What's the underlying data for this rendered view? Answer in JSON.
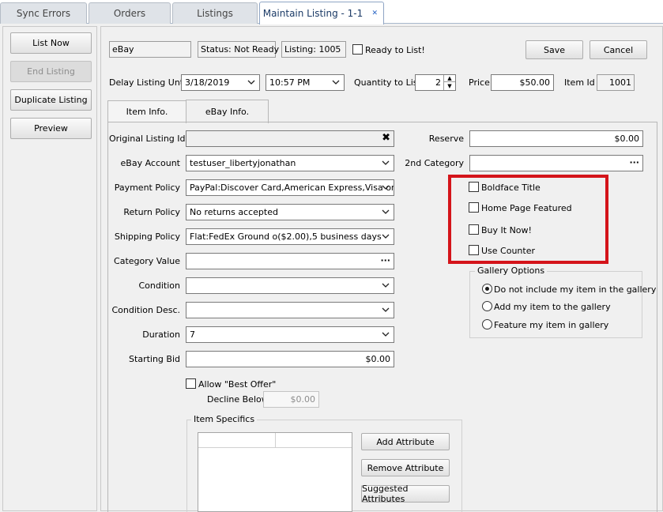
{
  "tabs": [
    {
      "label": "Sync Errors"
    },
    {
      "label": "Orders"
    },
    {
      "label": "Listings"
    },
    {
      "label": "Maintain Listing - 1-1",
      "active": true
    }
  ],
  "left_buttons": {
    "list_now": "List Now",
    "end_listing": "End Listing",
    "duplicate_listing": "Duplicate Listing",
    "preview": "Preview"
  },
  "header": {
    "marketplace": "eBay",
    "status": "Status: Not Ready",
    "listing": "Listing: 1005",
    "ready_label": "Ready to List!",
    "save": "Save",
    "cancel": "Cancel"
  },
  "row2": {
    "delay_label": "Delay Listing Until",
    "date": "3/18/2019",
    "time": "10:57 PM",
    "qty_label": "Quantity to List",
    "qty": "2",
    "price_label": "Price",
    "price": "$50.00",
    "itemid_label": "Item Id",
    "itemid": "1001"
  },
  "inner_tabs": [
    {
      "label": "Item Info."
    },
    {
      "label": "eBay Info.",
      "active": true
    }
  ],
  "form": {
    "original_listing_id_label": "Original Listing Id",
    "original_listing_id": "",
    "ebay_account_label": "eBay Account",
    "ebay_account": "testuser_libertyjonathan",
    "payment_policy_label": "Payment Policy",
    "payment_policy": "PayPal:Discover Card,American Express,Visa or",
    "return_policy_label": "Return Policy",
    "return_policy": "No returns accepted",
    "shipping_policy_label": "Shipping Policy",
    "shipping_policy": "Flat:FedEx Ground o($2.00),5 business days",
    "category_value_label": "Category Value",
    "category_value": "",
    "condition_label": "Condition",
    "condition": "",
    "condition_desc_label": "Condition Desc.",
    "condition_desc": "",
    "duration_label": "Duration",
    "duration": "7",
    "starting_bid_label": "Starting Bid",
    "starting_bid": "$0.00",
    "allow_best_offer_label": "Allow \"Best Offer\"",
    "decline_below_label": "Decline Below",
    "decline_below": "$0.00"
  },
  "item_specifics": {
    "title": "Item Specifics",
    "add": "Add Attribute",
    "remove": "Remove Attribute",
    "suggested": "Suggested Attributes"
  },
  "right": {
    "reserve_label": "Reserve",
    "reserve": "$0.00",
    "second_category_label": "2nd Category",
    "second_category": "",
    "options": [
      "Boldface Title",
      "Home Page Featured",
      "Buy It Now!",
      "Use Counter"
    ],
    "gallery_title": "Gallery Options",
    "gallery_options": [
      "Do not include my item in the gallery",
      "Add my item to the gallery",
      "Feature my item in gallery"
    ],
    "gallery_selected_index": 0
  },
  "colors": {
    "highlight": "#d4141a",
    "active_tab_text": "#1b3a66"
  }
}
